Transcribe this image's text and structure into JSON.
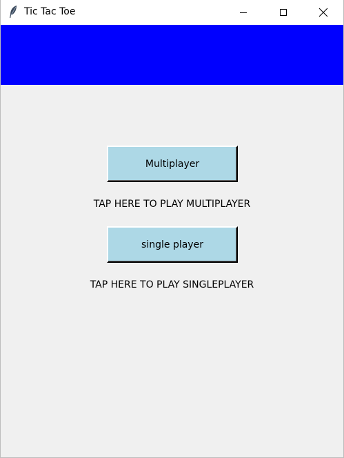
{
  "window": {
    "title": "Tic Tac Toe",
    "icon": "feather-icon",
    "controls": {
      "minimize_icon": "minimize-icon",
      "maximize_icon": "maximize-icon",
      "close_icon": "close-icon"
    }
  },
  "colors": {
    "header": "#0000ff",
    "background": "#f0f0f0",
    "button": "#add8e6"
  },
  "menu": {
    "multiplayer_button": "Multiplayer",
    "multiplayer_caption": "TAP HERE TO PLAY MULTIPLAYER",
    "singleplayer_button": "single player",
    "singleplayer_caption": "TAP HERE TO PLAY SINGLEPLAYER"
  }
}
